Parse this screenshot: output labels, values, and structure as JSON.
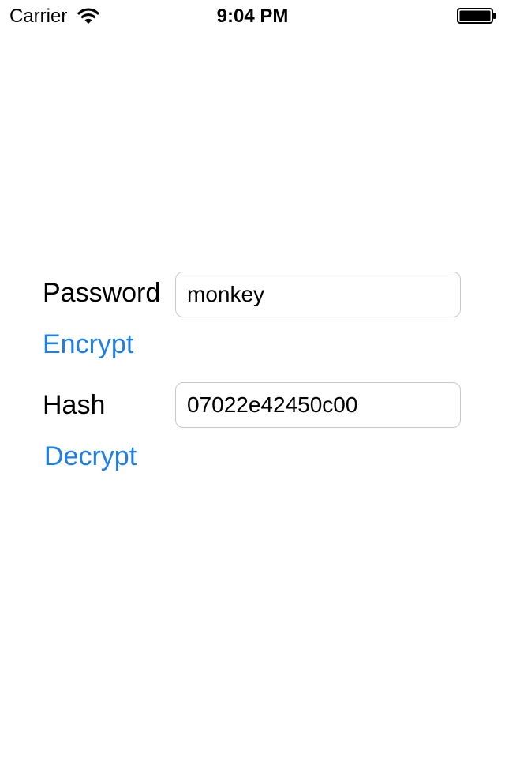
{
  "status_bar": {
    "carrier": "Carrier",
    "time": "9:04 PM",
    "wifi_icon": "wifi-icon",
    "battery_icon": "battery-full-icon"
  },
  "form": {
    "password_label": "Password",
    "password_value": "monkey",
    "encrypt_label": "Encrypt",
    "hash_label": "Hash",
    "hash_value": "07022e42450c00",
    "decrypt_label": "Decrypt"
  },
  "colors": {
    "accent": "#1f7fe6",
    "field_border": "#c8c8cc",
    "text": "#000000",
    "background": "#ffffff"
  }
}
